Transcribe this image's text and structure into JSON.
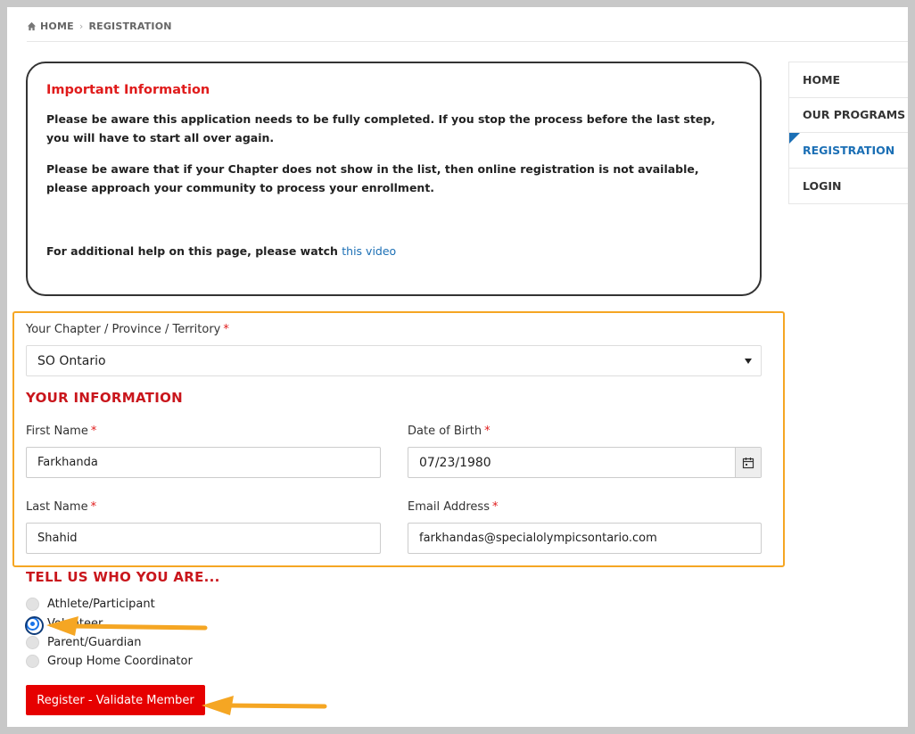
{
  "breadcrumb": {
    "home": "HOME",
    "current": "REGISTRATION"
  },
  "info": {
    "title": "Important Information",
    "p1": "Please be aware this application needs to be fully completed.  If you stop the process before the last step, you will have to start all over again.",
    "p2": "Please be aware that if your Chapter does not show in the list, then online registration is not available, please approach your community to process your enrollment.",
    "help_prefix": "For additional help on this page, please watch ",
    "help_link": "this video"
  },
  "nav": {
    "items": [
      {
        "label": "HOME",
        "active": false
      },
      {
        "label": "OUR PROGRAMS",
        "active": false
      },
      {
        "label": "REGISTRATION",
        "active": true
      },
      {
        "label": "LOGIN",
        "active": false
      }
    ]
  },
  "form": {
    "chapter_label": "Your Chapter / Province / Territory",
    "chapter_value": "SO Ontario",
    "section_info": "YOUR INFORMATION",
    "first_name_label": "First Name",
    "first_name_value": "Farkhanda",
    "dob_label": "Date of Birth",
    "dob_value": "07/23/1980",
    "last_name_label": "Last Name",
    "last_name_value": "Shahid",
    "email_label": "Email Address",
    "email_value": "farkhandas@specialolympicsontario.com",
    "required_mark": "*",
    "section_who": "TELL US WHO YOU ARE...",
    "roles": [
      {
        "label": "Athlete/Participant",
        "checked": false
      },
      {
        "label": "Volunteer",
        "checked": true
      },
      {
        "label": "Parent/Guardian",
        "checked": false
      },
      {
        "label": "Group Home Coordinator",
        "checked": false
      }
    ],
    "submit_label": "Register - Validate Member"
  },
  "colors": {
    "accent_red": "#e60000",
    "title_red": "#c9161c",
    "link_blue": "#1b6fb5",
    "highlight_orange": "#f5a623"
  }
}
